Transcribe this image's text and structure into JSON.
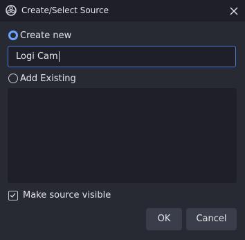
{
  "window": {
    "title": "Create/Select Source",
    "app_icon": "obs-logo-icon",
    "close_icon": "close-icon"
  },
  "create_new": {
    "label": "Create new",
    "selected": true
  },
  "name_input": {
    "value": "Logi Cam"
  },
  "add_existing": {
    "label": "Add Existing",
    "selected": false
  },
  "existing_list": {
    "items": []
  },
  "make_visible": {
    "label": "Make source visible",
    "checked": true
  },
  "buttons": {
    "ok": "OK",
    "cancel": "Cancel"
  },
  "colors": {
    "accent": "#6ea3ff",
    "input_border": "#4a7bd6",
    "dialog_bg": "#272a33",
    "field_bg": "#1e1f29",
    "button_bg": "#3a3e4b"
  }
}
